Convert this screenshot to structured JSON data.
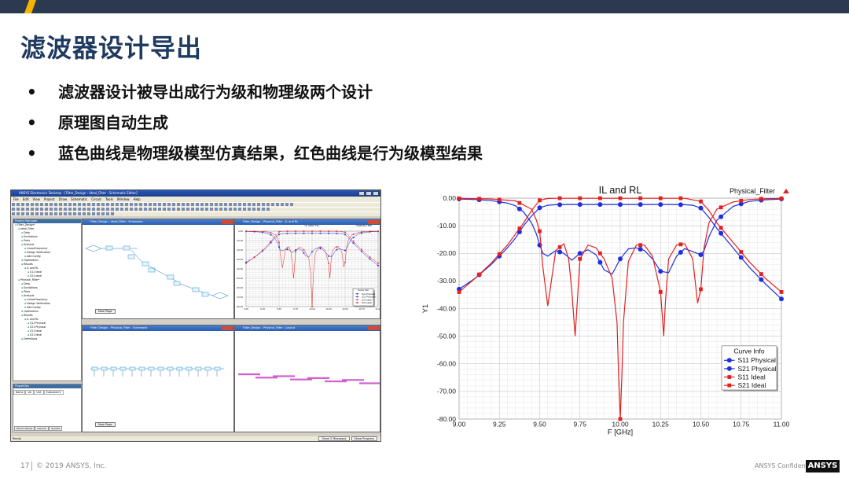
{
  "slide": {
    "title": "滤波器设计导出",
    "bullets": [
      "滤波器设计被导出成行为级和物理级两个设计",
      "原理图自动生成",
      "蓝色曲线是物理级模型仿真结果，红色曲线是行为级模型结果"
    ],
    "page_number": "17",
    "copyright": "© 2019 ANSYS, Inc.",
    "confidential": "ANSYS Confidential",
    "logo_text": "ANSYS"
  },
  "app": {
    "window_title": "ANSYS Electronics Desktop - [Filter_Design - Ideal_Filter - Schematic Editor]",
    "menu": [
      "File",
      "Edit",
      "View",
      "Project",
      "Draw",
      "Schematic",
      "Circuit",
      "Tools",
      "Window",
      "Help"
    ],
    "project_manager_title": "Project Manager",
    "tree": [
      "Filter_Design*",
      "Ideal_Filter",
      "Data",
      "Excitations",
      "Ports",
      "Analysis",
      "LinearFrequency",
      "Design Verification",
      "Add Config",
      "Optimetrics",
      "Results",
      "IL and RL",
      "S11 Ideal",
      "S21 Ideal",
      "Physical_Filter*",
      "Data",
      "Excitations",
      "Ports",
      "Analysis",
      "LinearFrequency",
      "Design Verification",
      "Add Config",
      "Optimetrics",
      "Results",
      "IL and RL",
      "S11 Physical",
      "S21 Physical",
      "S11 Ideal",
      "S21 Ideal",
      "Definitions"
    ],
    "properties_title": "Properties",
    "properties_cols": [
      "Name",
      "Val",
      "Unit",
      "Evaluated V"
    ],
    "properties_tabs": [
      "Param Values",
      "General",
      "Symbol"
    ],
    "windows": {
      "w1": "Filter_Design - Ideal_Filter - Schematic",
      "w2": "Filter_Design - Physical_Filter - IL and RL",
      "w3": "Filter_Design - Physical_Filter - Schematic",
      "w4": "Filter_Design - Physical_Filter - Layout"
    },
    "new_page": "New Page",
    "status_ready": "Ready",
    "status_buttons": [
      "Show 2 Messages",
      "Show Progress"
    ]
  },
  "chart_data": {
    "type": "line",
    "title": "IL and RL",
    "design_label": "Physical_Filter",
    "xlabel": "F [GHz]",
    "ylabel": "Y1",
    "xlim": [
      9.0,
      11.0
    ],
    "ylim": [
      -80,
      0
    ],
    "xticks": [
      "9.00",
      "9.25",
      "9.50",
      "9.75",
      "10.00",
      "10.25",
      "10.50",
      "10.75",
      "11.00"
    ],
    "yticks": [
      "0.00",
      "-10.00",
      "-20.00",
      "-30.00",
      "-40.00",
      "-50.00",
      "-60.00",
      "-70.00",
      "-80.00"
    ],
    "grid": true,
    "legend_title": "Curve Info",
    "legend_placement": "bottom-right",
    "series": [
      {
        "name": "S11 Physical",
        "color": "#1f2fe0",
        "marker": "circle",
        "x": [
          9.0,
          9.1,
          9.2,
          9.3,
          9.35,
          9.4,
          9.45,
          9.48,
          9.5,
          9.52,
          9.55,
          9.6,
          9.65,
          9.7,
          9.75,
          9.8,
          9.85,
          9.9,
          9.95,
          10.0,
          10.05,
          10.1,
          10.15,
          10.2,
          10.25,
          10.3,
          10.35,
          10.4,
          10.45,
          10.5,
          10.52,
          10.55,
          10.6,
          10.7,
          10.8,
          10.9,
          11.0
        ],
        "y": [
          -0.3,
          -0.5,
          -0.9,
          -1.8,
          -2.8,
          -5,
          -9,
          -13,
          -17,
          -20,
          -21,
          -19,
          -20,
          -22.5,
          -20,
          -18.7,
          -20.5,
          -26,
          -27.5,
          -22,
          -18.4,
          -18,
          -19,
          -22,
          -26.5,
          -27,
          -21,
          -18.3,
          -19.4,
          -20.5,
          -19,
          -14,
          -8,
          -3,
          -1.2,
          -0.6,
          -0.3
        ]
      },
      {
        "name": "S21 Physical",
        "color": "#1f2fe0",
        "marker": "circle",
        "x": [
          9.0,
          9.1,
          9.2,
          9.3,
          9.35,
          9.4,
          9.45,
          9.5,
          9.55,
          9.6,
          9.7,
          9.8,
          9.9,
          10.0,
          10.1,
          10.2,
          10.3,
          10.4,
          10.45,
          10.5,
          10.55,
          10.6,
          10.7,
          10.8,
          10.9,
          11.0
        ],
        "y": [
          -33,
          -29,
          -24,
          -18,
          -14.5,
          -10,
          -6.5,
          -3.5,
          -2.6,
          -2.4,
          -2.3,
          -2.3,
          -2.3,
          -2.3,
          -2.3,
          -2.3,
          -2.3,
          -2.4,
          -2.6,
          -3.6,
          -7,
          -11,
          -18,
          -25,
          -31,
          -36.5
        ]
      },
      {
        "name": "S11 Ideal",
        "color": "#e32020",
        "marker": "square",
        "x": [
          9.0,
          9.2,
          9.35,
          9.45,
          9.48,
          9.5,
          9.52,
          9.55,
          9.6,
          9.65,
          9.68,
          9.7,
          9.72,
          9.75,
          9.8,
          9.85,
          9.9,
          9.95,
          9.98,
          9.99,
          10.0,
          10.01,
          10.02,
          10.05,
          10.1,
          10.15,
          10.2,
          10.25,
          10.27,
          10.28,
          10.3,
          10.35,
          10.4,
          10.45,
          10.48,
          10.5,
          10.52,
          10.55,
          10.6,
          10.7,
          10.8,
          10.9,
          11.0
        ],
        "y": [
          -0.1,
          -0.3,
          -1,
          -4,
          -8,
          -12,
          -25,
          -39,
          -19,
          -16.5,
          -22,
          -34,
          -50,
          -22,
          -17,
          -18,
          -22,
          -29,
          -45,
          -65,
          -80,
          -65,
          -45,
          -23,
          -17,
          -17,
          -21,
          -34,
          -50,
          -38,
          -22,
          -17,
          -16.5,
          -22,
          -38,
          -33,
          -18,
          -9,
          -4,
          -1.4,
          -0.5,
          -0.2,
          -0.1
        ]
      },
      {
        "name": "S21 Ideal",
        "color": "#e32020",
        "marker": "square",
        "x": [
          9.0,
          9.1,
          9.2,
          9.3,
          9.35,
          9.4,
          9.45,
          9.5,
          9.55,
          9.6,
          9.7,
          9.8,
          9.9,
          10.0,
          10.1,
          10.2,
          10.3,
          10.4,
          10.5,
          10.55,
          10.6,
          10.7,
          10.8,
          10.9,
          11.0
        ],
        "y": [
          -34,
          -29,
          -23.5,
          -17,
          -13,
          -9,
          -4.5,
          -0.8,
          -0.1,
          -0.05,
          -0.05,
          -0.05,
          -0.05,
          -0.05,
          -0.05,
          -0.05,
          -0.05,
          -0.05,
          -1.2,
          -4.5,
          -9,
          -16,
          -23,
          -29,
          -34
        ]
      }
    ]
  }
}
